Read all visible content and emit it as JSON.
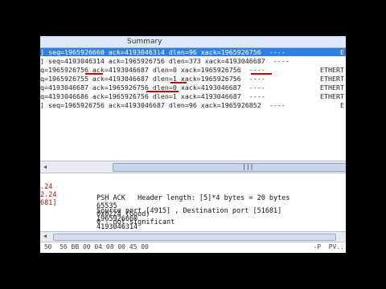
{
  "summary": {
    "title": "Summary"
  },
  "packet_rows": [
    {
      "text": "] seq=1965926660 ack=4193046314 dlen=96 xack=1965926756  ----",
      "tail": "E"
    },
    {
      "text": "] seq=4193046314 ack=1965926756 dlen=373 xack=4193046687  ----",
      "tail": ""
    },
    {
      "text": "q=1965926756 ack=4193046687 dlen=0 xack=1965926756  ----",
      "tail": "ETHERT"
    },
    {
      "text": "q=1965926755 ack=4193046687 dlen=1 xack=1965926756  ----",
      "tail": "ETHERT"
    },
    {
      "text": "q=4193046687 ack=1965926756 dlen=0 xack=4193046687  ----",
      "tail": "ETHERT"
    },
    {
      "text": "q=4193046686 ack=1965926756 dlen=1 xack=4193046687  ----",
      "tail": "ETHERT"
    },
    {
      "text": "] seq=1965926756 ack=4193046687 dlen=96 xack=1965926852  ----",
      "tail": "E"
    }
  ],
  "scroll_grip": "|||",
  "details": {
    "left_lines": [
      ".24",
      "2.24",
      "681]"
    ],
    "fields": [
      "Source port [4915] , Destination port [51681]",
      "1965926660",
      "4193046314",
      "PSH ACK   Header length: [5]*4 bytes = 20 bytes",
      "65535",
      "0x0224 (Good)",
      "0 - not significant"
    ]
  },
  "hex_strip": {
    "hex": " 50  56 BB 00 04 08 00 45 00",
    "ascii": "-P  PV.."
  }
}
